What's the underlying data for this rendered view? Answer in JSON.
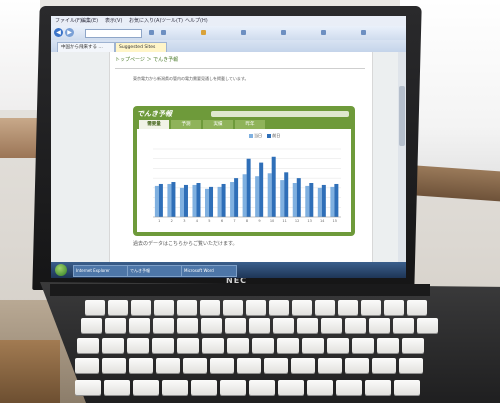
{
  "laptop": {
    "brand": "NEC"
  },
  "browser": {
    "menu": [
      "ファイル(F)",
      "編集(E)",
      "表示(V)",
      "お気に入り(A)",
      "ツール(T)",
      "ヘルプ(H)"
    ],
    "tabs": [
      {
        "label": "中国から飛来する …",
        "highlight": false
      },
      {
        "label": "Suggested Sites",
        "highlight": true
      }
    ]
  },
  "page": {
    "breadcrumb": "トップページ ＞ でんき予報",
    "intro": "東京電力から新潟県の管内の電力需要見通しを掲載しています。",
    "chart_panel": {
      "title": "でんき予報",
      "tabs": [
        "需要量",
        "予測",
        "実績",
        "昨年"
      ],
      "active_tab": 0,
      "legend": [
        "当日",
        "前日"
      ],
      "colors": {
        "series1": "#7fb0e0",
        "series2": "#2f6fb8",
        "panel": "#6e9a3a"
      }
    },
    "below_text": "過去のデータはこちらからご覧いただけます。"
  },
  "chart_data": {
    "type": "bar",
    "categories": [
      "1",
      "2",
      "3",
      "4",
      "5",
      "6",
      "7",
      "8",
      "9",
      "10",
      "11",
      "12",
      "13",
      "14",
      "15"
    ],
    "series": [
      {
        "values": [
          3.2,
          3.4,
          3.0,
          3.3,
          2.9,
          3.1,
          3.6,
          4.4,
          4.2,
          4.5,
          3.8,
          3.5,
          3.2,
          3.0,
          3.1
        ]
      },
      {
        "values": [
          3.4,
          3.6,
          3.3,
          3.5,
          3.1,
          3.4,
          4.0,
          6.0,
          5.6,
          6.2,
          4.6,
          4.0,
          3.5,
          3.3,
          3.4
        ]
      }
    ],
    "ylim": [
      0,
      7
    ],
    "grid": true
  },
  "taskbar": {
    "items": [
      "Internet Explorer",
      "でんき予報",
      "Microsoft Word"
    ]
  }
}
